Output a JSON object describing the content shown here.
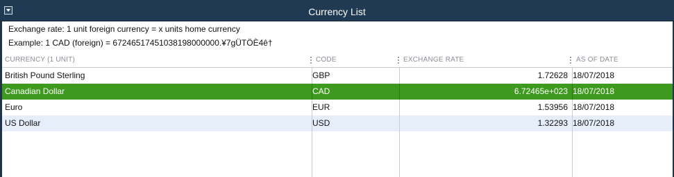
{
  "window": {
    "title": "Currency List"
  },
  "info": {
    "line1": "Exchange rate: 1 unit foreign currency = x units home currency",
    "line2": "Example: 1 CAD (foreign) = 67246517451038198000000.¥7gÜTÖÈ4ê†"
  },
  "table": {
    "columns": [
      {
        "label": "CURRENCY (1 UNIT)"
      },
      {
        "label": "CODE"
      },
      {
        "label": "EXCHANGE RATE"
      },
      {
        "label": "AS OF DATE"
      }
    ],
    "rows": [
      {
        "name": "British Pound Sterling",
        "code": "GBP",
        "rate": "1.72628",
        "date": "18/07/2018"
      },
      {
        "name": "Canadian Dollar",
        "code": "CAD",
        "rate": "6.72465e+023",
        "date": "18/07/2018"
      },
      {
        "name": "Euro",
        "code": "EUR",
        "rate": "1.53956",
        "date": "18/07/2018"
      },
      {
        "name": "US Dollar",
        "code": "USD",
        "rate": "1.32293",
        "date": "18/07/2018"
      }
    ],
    "selected_row": 1
  },
  "colors": {
    "titlebar": "#1f3a52",
    "selected_row": "#3e9a1f",
    "alt_row": "#e6eefa"
  },
  "icons": {
    "title_menu": "dropdown-menu-icon"
  }
}
